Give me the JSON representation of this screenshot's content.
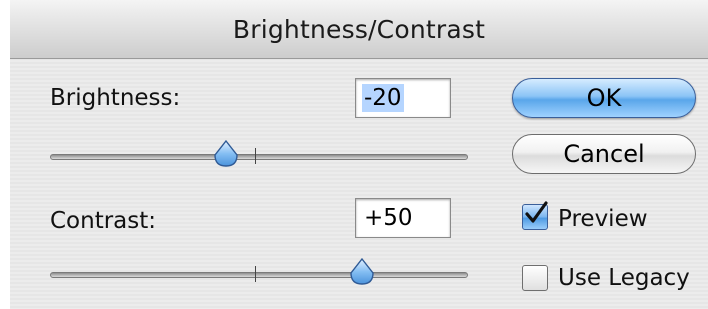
{
  "dialog": {
    "title": "Brightness/Contrast"
  },
  "brightness": {
    "label": "Brightness:",
    "value": "-20"
  },
  "contrast": {
    "label": "Contrast:",
    "value": "+50"
  },
  "buttons": {
    "ok_label": "OK",
    "cancel_label": "Cancel"
  },
  "options": {
    "preview_label": "Preview",
    "preview_checked": true,
    "use_legacy_label": "Use Legacy",
    "use_legacy_checked": false
  },
  "colors": {
    "accent": "#5aa6ea",
    "selection": "#b5d5ff"
  }
}
